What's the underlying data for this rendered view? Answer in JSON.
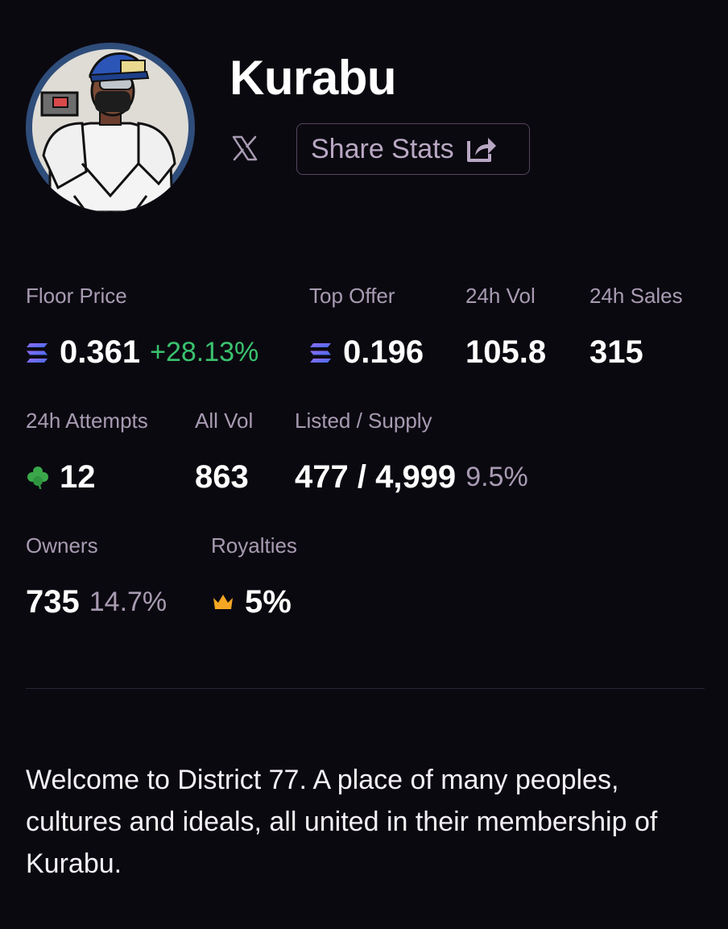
{
  "collection": {
    "name": "Kurabu",
    "avatar_alt": "avatar",
    "social": {
      "icon": "x-logo-icon"
    },
    "share_button": {
      "label": "Share Stats",
      "icon": "share-icon"
    }
  },
  "stats": {
    "floor_price": {
      "label": "Floor Price",
      "value": "0.361",
      "change": "+28.13%",
      "icon": "solana-icon"
    },
    "top_offer": {
      "label": "Top Offer",
      "value": "0.196",
      "icon": "solana-icon"
    },
    "vol_24h": {
      "label": "24h Vol",
      "value": "105.8"
    },
    "sales_24h": {
      "label": "24h Sales",
      "value": "315"
    },
    "attempts_24h": {
      "label": "24h Attempts",
      "value": "12",
      "icon": "clover-icon"
    },
    "all_vol": {
      "label": "All Vol",
      "value": "863"
    },
    "listed_supply": {
      "label": "Listed / Supply",
      "value": "477 / 4,999",
      "percent": "9.5%"
    },
    "owners": {
      "label": "Owners",
      "value": "735",
      "percent": "14.7%"
    },
    "royalties": {
      "label": "Royalties",
      "value": "5%",
      "icon": "crown-icon"
    }
  },
  "description": "Welcome to District 77. A place of many peoples, cultures and ideals, all united in their membership of Kurabu.",
  "colors": {
    "background": "#0b0910",
    "positive": "#3ac26f",
    "muted": "#a89bb2",
    "border": "#54465e",
    "avatar_ring": "#2f4d7a"
  }
}
